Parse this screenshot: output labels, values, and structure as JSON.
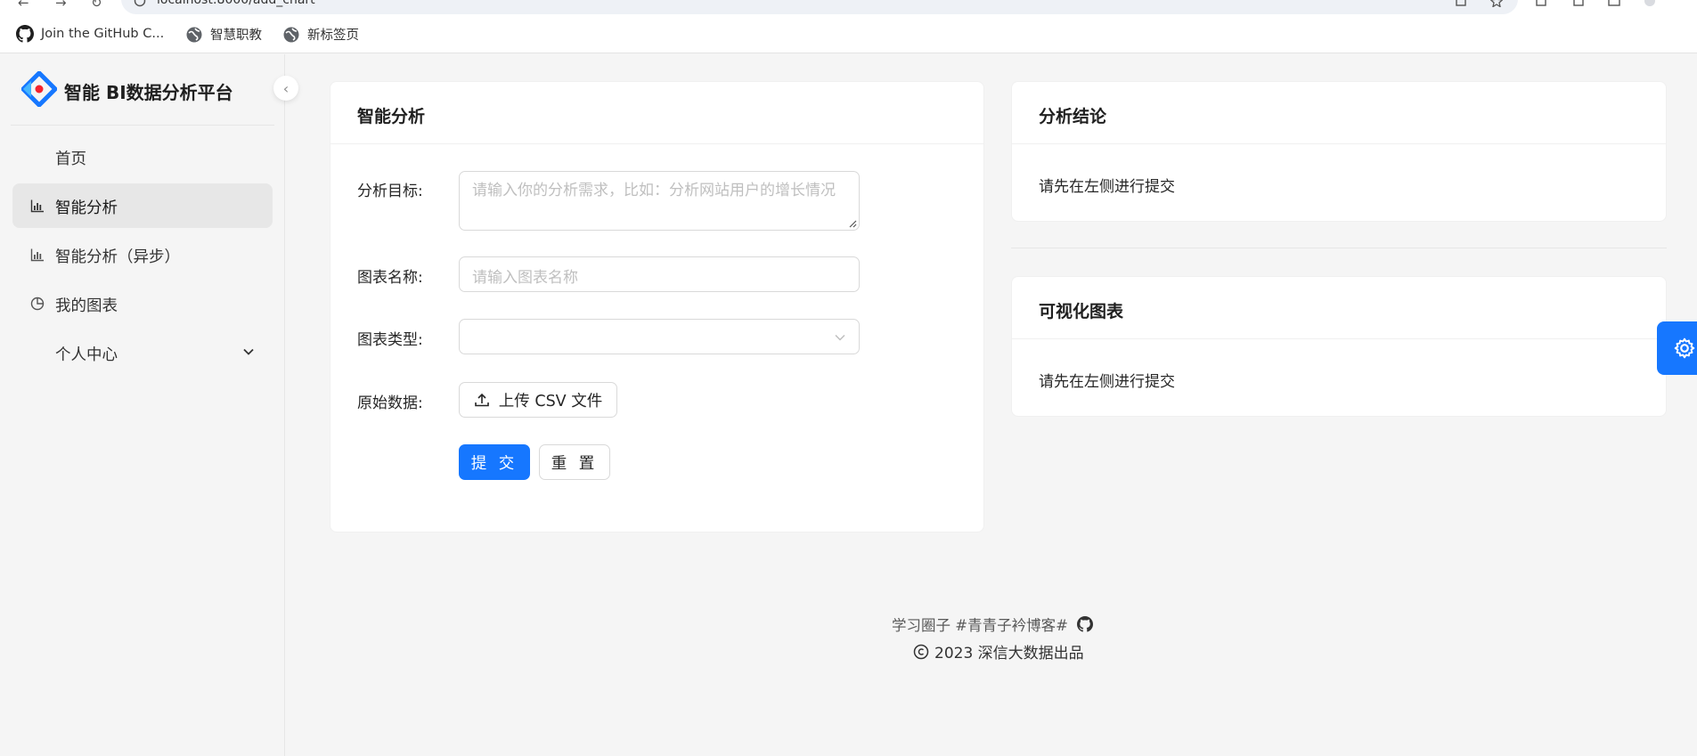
{
  "browser": {
    "url": "localhost:8000/add_chart",
    "bookmarks": [
      {
        "label": "Join the GitHub C...",
        "icon": "github-icon"
      },
      {
        "label": "智慧职教",
        "icon": "globe-icon"
      },
      {
        "label": "新标签页",
        "icon": "globe-icon"
      }
    ]
  },
  "sidebar": {
    "app_title": "智能 BI数据分析平台",
    "items": [
      {
        "label": "首页",
        "icon": ""
      },
      {
        "label": "智能分析",
        "icon": "bar-chart-icon",
        "active": true
      },
      {
        "label": "智能分析（异步）",
        "icon": "bar-chart-icon"
      },
      {
        "label": "我的图表",
        "icon": "pie-chart-icon"
      },
      {
        "label": "个人中心",
        "icon": "",
        "expandable": true
      }
    ]
  },
  "analysis_form": {
    "title": "智能分析",
    "goal_label": "分析目标:",
    "goal_placeholder": "请输入你的分析需求，比如：分析网站用户的增长情况",
    "name_label": "图表名称:",
    "name_placeholder": "请输入图表名称",
    "type_label": "图表类型:",
    "type_value": "",
    "data_label": "原始数据:",
    "upload_label": "上传 CSV 文件",
    "submit_label": "提 交",
    "reset_label": "重 置"
  },
  "conclusion": {
    "title": "分析结论",
    "text": "请先在左侧进行提交"
  },
  "visualization": {
    "title": "可视化图表",
    "text": "请先在左侧进行提交"
  },
  "footer": {
    "links": "学习圈子  #青青子衿博客#",
    "copyright": "2023 深信大数据出品"
  },
  "colors": {
    "primary": "#1677ff",
    "background": "#f5f5f5",
    "active_menu_bg": "#e7e7e7"
  }
}
